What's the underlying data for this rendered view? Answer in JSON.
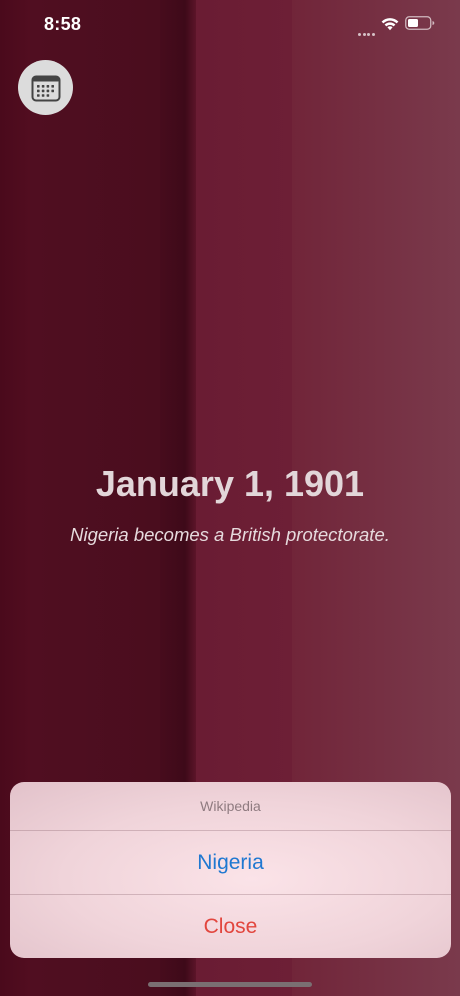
{
  "status_bar": {
    "time": "8:58"
  },
  "icons": {
    "calendar": "calendar-icon",
    "wifi": "wifi-icon",
    "battery": "battery-icon"
  },
  "event": {
    "date": "January 1, 1901",
    "description": "Nigeria becomes a British protectorate."
  },
  "action_sheet": {
    "title": "Wikipedia",
    "primary_action": "Nigeria",
    "close_action": "Close"
  },
  "colors": {
    "background_accent": "#6e2239",
    "primary_action": "#1f78d1",
    "destructive_action": "#e2463e"
  }
}
